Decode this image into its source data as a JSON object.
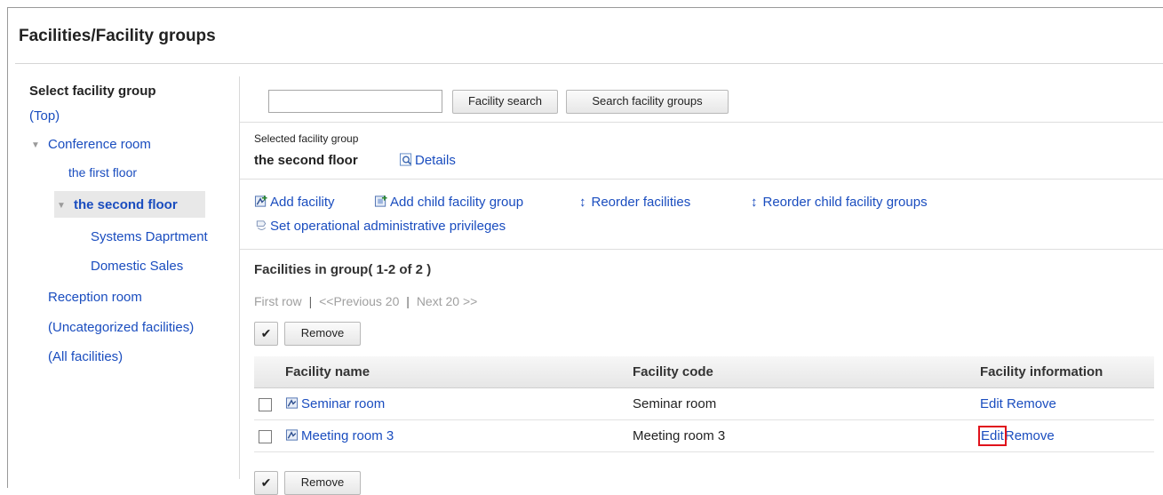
{
  "page": {
    "title": "Facilities/Facility groups"
  },
  "sidebar": {
    "heading": "Select facility group",
    "items": [
      {
        "label": "(Top)"
      },
      {
        "label": "Conference room"
      },
      {
        "label": "the first floor"
      },
      {
        "label": "the second floor"
      },
      {
        "label": "Systems Daprtment"
      },
      {
        "label": "Domestic Sales"
      },
      {
        "label": "Reception room"
      },
      {
        "label": "(Uncategorized facilities)"
      },
      {
        "label": "(All facilities)"
      }
    ]
  },
  "search": {
    "value": "",
    "facility_search_label": "Facility search",
    "group_search_label": "Search facility groups"
  },
  "selected_group": {
    "caption": "Selected facility group",
    "name": "the second floor",
    "details_label": "Details"
  },
  "actions": {
    "add_facility": "Add facility",
    "add_child_group": "Add child facility group",
    "reorder_facilities": "Reorder facilities",
    "reorder_child_groups": "Reorder child facility groups",
    "set_privileges": "Set operational administrative privileges"
  },
  "facilities": {
    "heading": "Facilities in group( 1-2 of 2 )",
    "pager": {
      "first": "First row",
      "prev": "<<Previous 20",
      "next": "Next 20 >>",
      "sep": "|"
    },
    "check_all_icon": "✔",
    "remove_label": "Remove",
    "columns": [
      "Facility name",
      "Facility code",
      "Facility information"
    ],
    "rows": [
      {
        "name": "Seminar room",
        "code": "Seminar room",
        "edit": "Edit",
        "remove": "Remove"
      },
      {
        "name": "Meeting room 3",
        "code": "Meeting room 3",
        "edit": "Edit",
        "remove": "Remove"
      }
    ]
  },
  "colors": {
    "link": "#1a4dbf",
    "highlight_box": "#e0121b"
  }
}
